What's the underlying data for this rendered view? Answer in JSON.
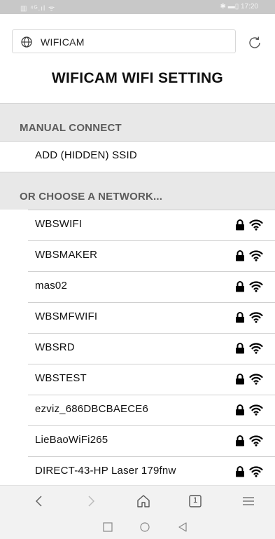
{
  "status_bar": {
    "left_text": "▥ ⁴ᴳ.ıl ᯤ",
    "right_text": "✱ ▬▯ 17:20"
  },
  "browser": {
    "url": "WIFICAM"
  },
  "page": {
    "title": "WIFICAM WIFI SETTING",
    "manual_header": "MANUAL CONNECT",
    "add_ssid_label": "ADD (HIDDEN) SSID",
    "choose_header": "OR CHOOSE A NETWORK..."
  },
  "networks": [
    {
      "ssid": "WBSWIFI",
      "secured": true
    },
    {
      "ssid": "WBSMAKER",
      "secured": true
    },
    {
      "ssid": "mas02",
      "secured": true
    },
    {
      "ssid": "WBSMFWIFI",
      "secured": true
    },
    {
      "ssid": "WBSRD",
      "secured": true
    },
    {
      "ssid": "WBSTEST",
      "secured": true
    },
    {
      "ssid": "ezviz_686DBCBAECE6",
      "secured": true
    },
    {
      "ssid": "LieBaoWiFi265",
      "secured": true
    },
    {
      "ssid": "DIRECT-43-HP Laser 179fnw",
      "secured": true
    }
  ],
  "bottom_nav": {
    "tab_count": "1"
  },
  "icons": {
    "globe": "globe-icon",
    "reload": "reload-icon",
    "lock": "lock-icon",
    "wifi": "wifi-icon",
    "back": "chevron-left-icon",
    "forward": "chevron-right-icon",
    "home": "home-icon",
    "tabs": "tabs-icon",
    "menu": "menu-icon",
    "recent": "recent-apps-icon",
    "sys_home": "circle-home-icon",
    "sys_back": "triangle-back-icon"
  },
  "colors": {
    "status_bar": "#c8c8c8",
    "section_header_bg": "#e8e8e8",
    "section_header_text": "#5c5c5c",
    "nav_bg": "#f2f2f2"
  }
}
